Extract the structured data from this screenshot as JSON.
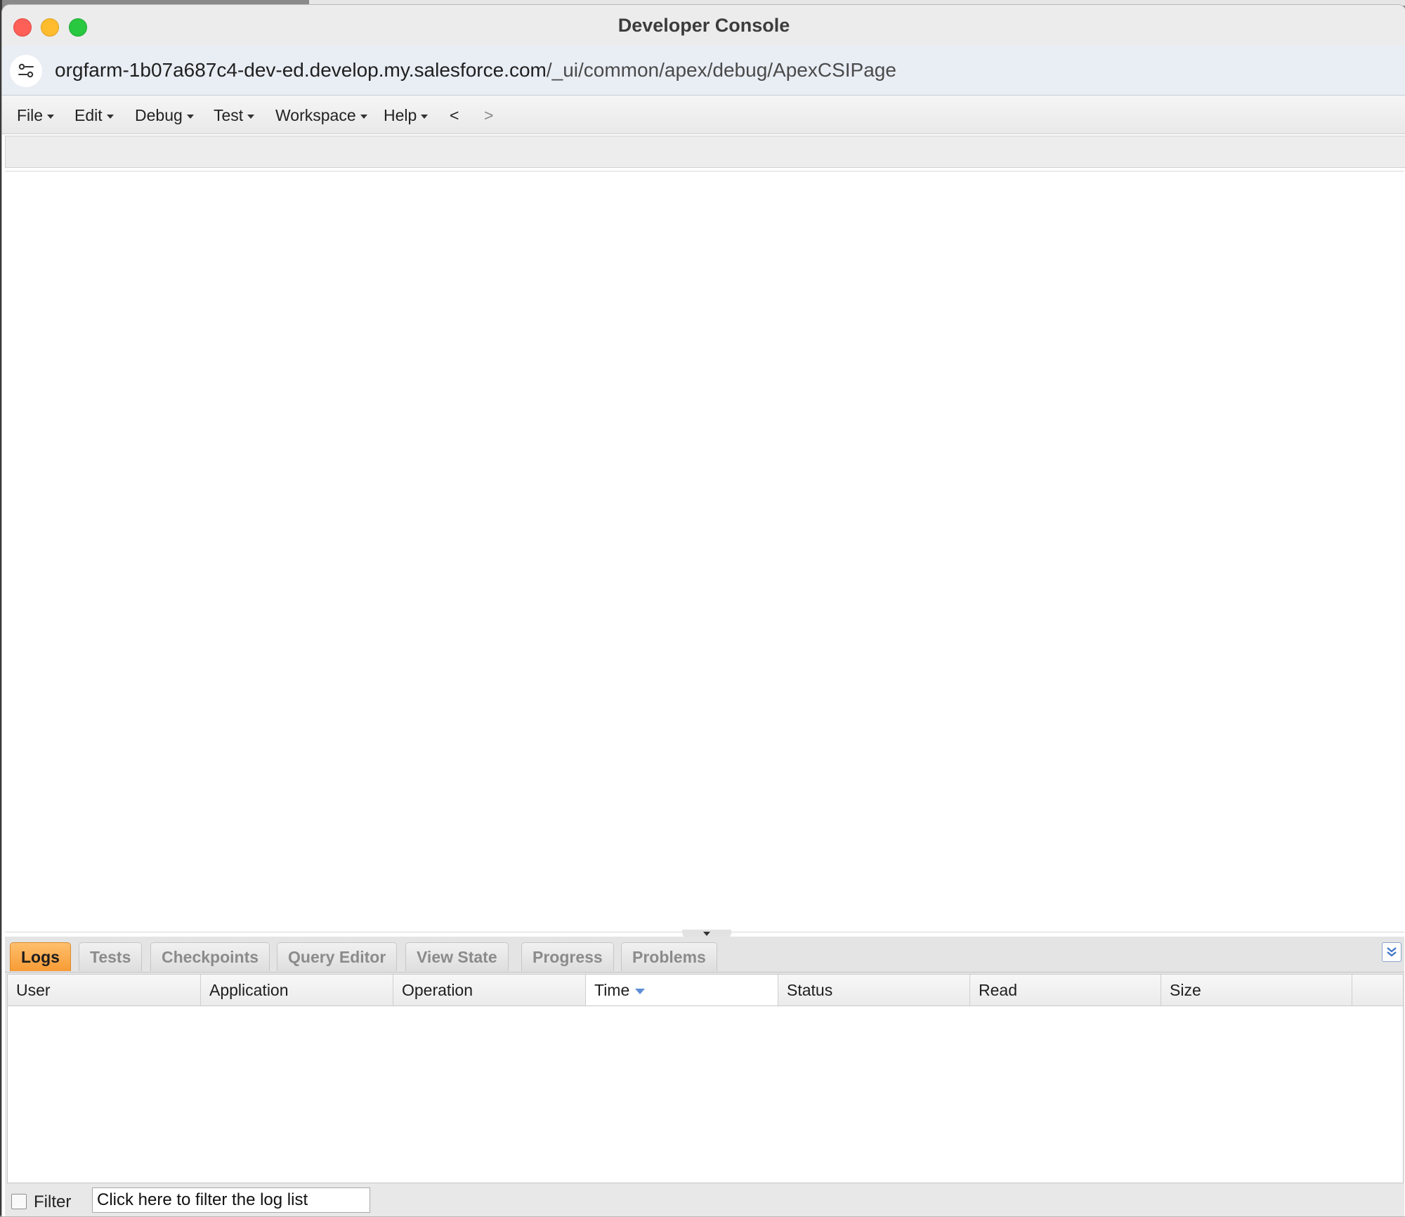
{
  "window": {
    "title": "Developer Console"
  },
  "urlbar": {
    "host": "orgfarm-1b07a687c4-dev-ed.develop.my.salesforce.com",
    "path": "/_ui/common/apex/debug/ApexCSIPage",
    "icon": "site-settings-icon"
  },
  "menu": {
    "items": [
      "File",
      "Edit",
      "Debug",
      "Test",
      "Workspace",
      "Help"
    ],
    "back": "<",
    "forward": ">"
  },
  "tabs": {
    "items": [
      "Logs",
      "Tests",
      "Checkpoints",
      "Query Editor",
      "View State",
      "Progress",
      "Problems"
    ],
    "active": "Logs"
  },
  "logs_table": {
    "columns": [
      "User",
      "Application",
      "Operation",
      "Time",
      "Status",
      "Read",
      "Size"
    ],
    "sorted_column": "Time",
    "sort_direction": "descending",
    "rows": []
  },
  "filter": {
    "label": "Filter",
    "checked": false,
    "placeholder": "Click here to filter the log list"
  },
  "colors": {
    "active_tab": "#f79b34",
    "sort_arrow": "#5b8fd3"
  }
}
